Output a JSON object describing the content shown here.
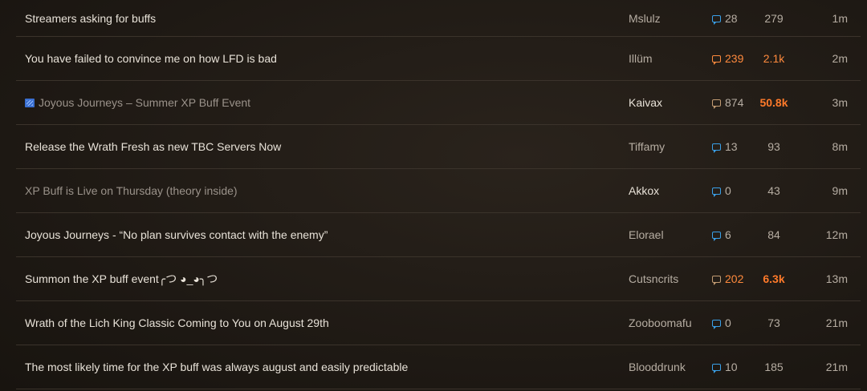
{
  "topics": [
    {
      "title": "Streamers asking for buffs",
      "author": "Mslulz",
      "replies": "28",
      "views": "279",
      "age": "1m"
    },
    {
      "title": "You have failed to convince me on how LFD is bad",
      "author": "Illüm",
      "replies": "239",
      "views": "2.1k",
      "age": "2m"
    },
    {
      "title": "Joyous Journeys – Summer XP Buff Event",
      "author": "Kaivax",
      "replies": "874",
      "views": "50.8k",
      "age": "3m"
    },
    {
      "title": "Release the Wrath Fresh as new TBC Servers Now",
      "author": "Tiffamy",
      "replies": "13",
      "views": "93",
      "age": "8m"
    },
    {
      "title": "XP Buff is Live on Thursday (theory inside)",
      "author": "Akkox",
      "replies": "0",
      "views": "43",
      "age": "9m"
    },
    {
      "title": "Joyous Journeys - “No plan survives contact with the enemy”",
      "author": "Elorael",
      "replies": "6",
      "views": "84",
      "age": "12m"
    },
    {
      "title": "Summon the XP buff event╭つ ◕_◕╮つ",
      "author": "Cutsncrits",
      "replies": "202",
      "views": "6.3k",
      "age": "13m"
    },
    {
      "title": "Wrath of the Lich King Classic Coming to You on August 29th",
      "author": "Zooboomafu",
      "replies": "0",
      "views": "73",
      "age": "21m"
    },
    {
      "title": "The most likely time for the XP buff was always august and easily predictable",
      "author": "Blooddrunk",
      "replies": "10",
      "views": "185",
      "age": "21m"
    }
  ],
  "colors": {
    "background": "#1f1a15",
    "text": "#e8e2d8",
    "muted": "#b6ada2",
    "hot": "#ff8a3d",
    "reply_bubble": "#3aa0e8"
  }
}
